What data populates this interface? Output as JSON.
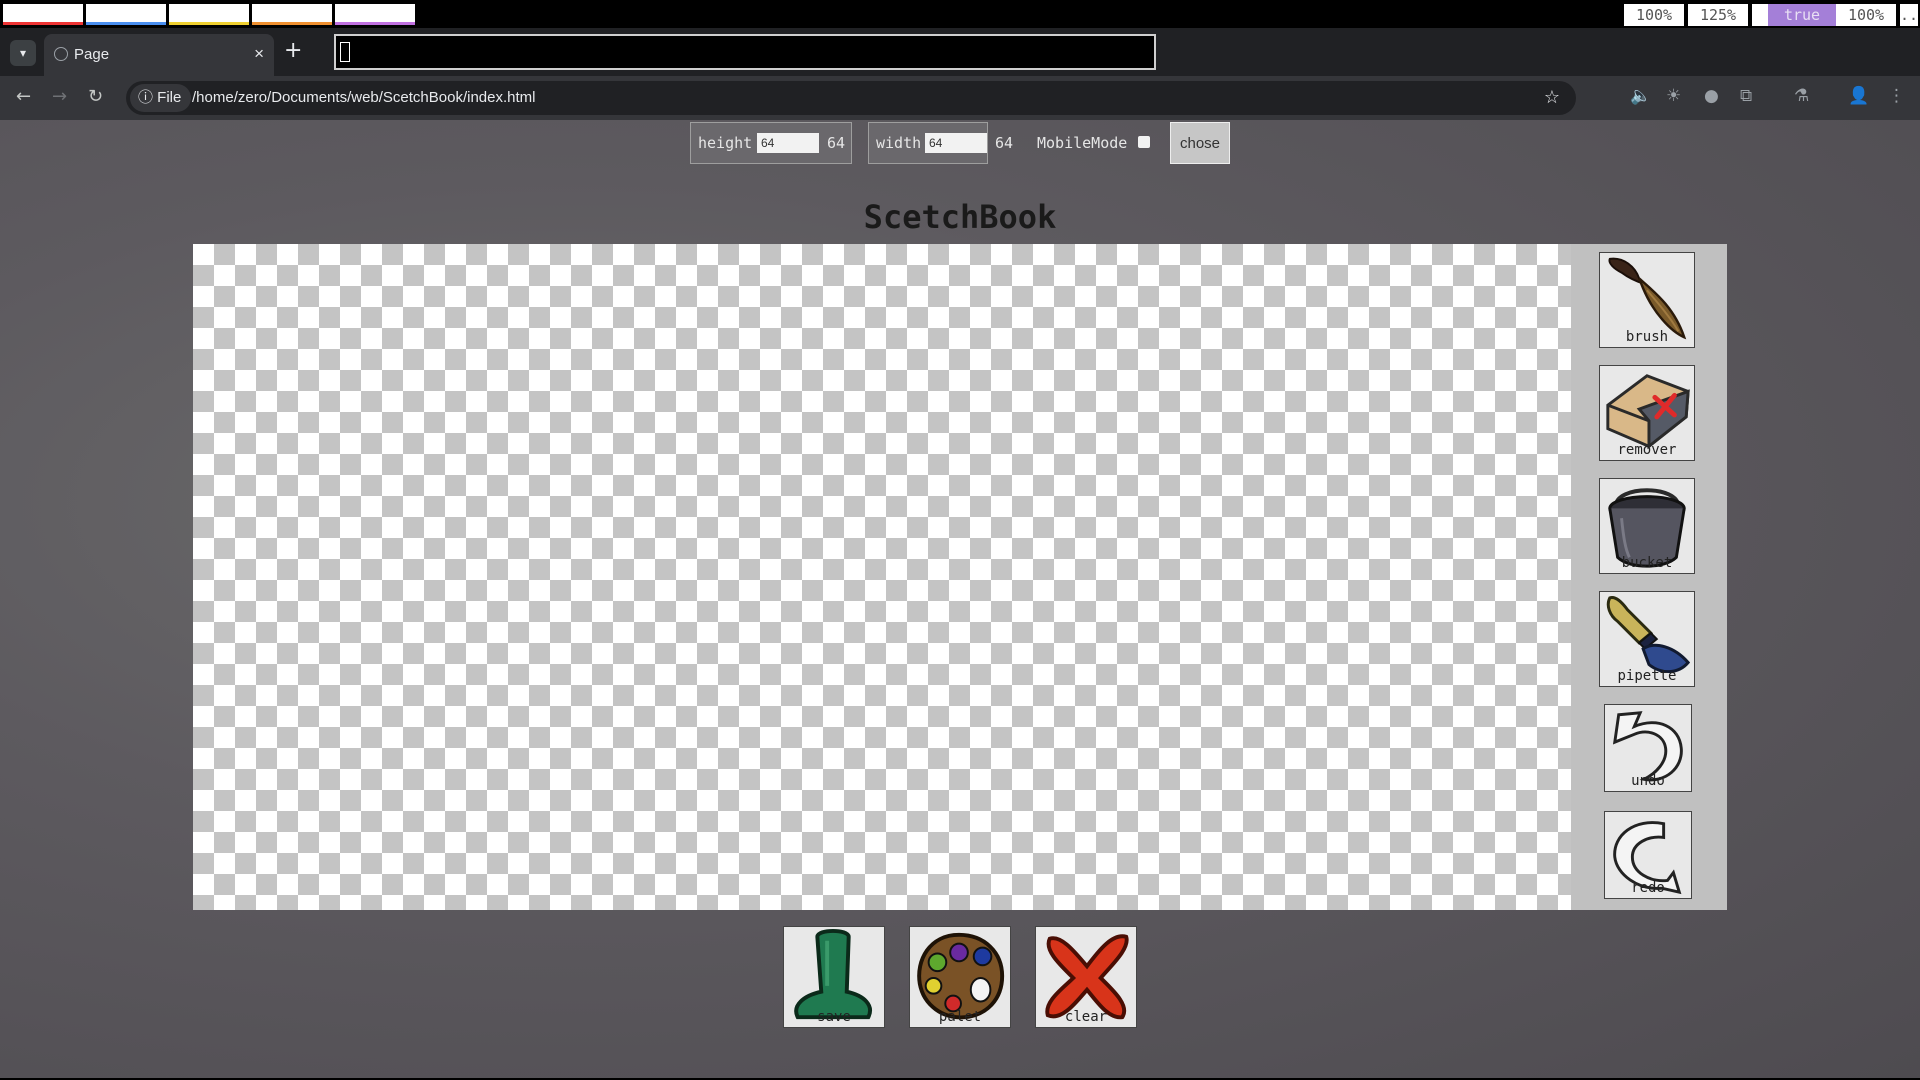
{
  "system_bar": {
    "indicators": [
      "100%",
      "125%",
      "true",
      "100%",
      ".."
    ]
  },
  "browser": {
    "tab_title": "Page",
    "omnibox_chip": "File",
    "url": "/home/zero/Documents/web/ScetchBook/index.html"
  },
  "controls": {
    "height_label": "height",
    "height_input": "64",
    "height_value": "64",
    "width_label": "width",
    "width_input": "64",
    "width_value": "64",
    "mobile_label": "MobileMode",
    "chose_label": "chose"
  },
  "app": {
    "title": "ScetchBook",
    "tools": [
      "brush",
      "remover",
      "bucket",
      "pipette",
      "undo",
      "redo"
    ],
    "bottom_buttons": [
      "save",
      "palet",
      "clear"
    ]
  },
  "colors": {
    "accent_indicator": "#a47fd8",
    "page_background": "#5d5a5f"
  }
}
